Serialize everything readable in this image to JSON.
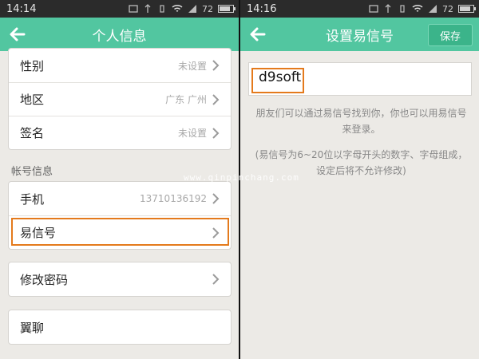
{
  "left": {
    "status": {
      "time": "14:14",
      "battery": "72",
      "battery_level": 0.72
    },
    "header": {
      "title": "个人信息"
    },
    "profile_rows": [
      {
        "label": "性别",
        "value": "未设置"
      },
      {
        "label": "地区",
        "value": "广东 广州"
      },
      {
        "label": "签名",
        "value": "未设置"
      }
    ],
    "account_section": {
      "title": "帐号信息",
      "rows": [
        {
          "label": "手机",
          "value": "13710136192"
        },
        {
          "label": "易信号",
          "value": ""
        }
      ]
    },
    "change_password": {
      "label": "修改密码"
    },
    "yiliao": {
      "label": "翼聊"
    }
  },
  "right": {
    "status": {
      "time": "14:16",
      "battery": "72",
      "battery_level": 0.72
    },
    "header": {
      "title": "设置易信号",
      "save_label": "保存"
    },
    "id_input": {
      "value": "d9soft"
    },
    "hint1": "朋友们可以通过易信号找到你，你也可以用易信号来登录。",
    "hint2": "(易信号为6~20位以字母开头的数字、字母组成，设定后将不允许修改)"
  },
  "watermark": "www.qinpinchang.com",
  "colors": {
    "accent": "#52c6a0",
    "highlight": "#e47a1c",
    "background": "#eceae6"
  },
  "icons": [
    "back-arrow-icon",
    "chevron-right-icon",
    "wifi-icon",
    "signal-icon",
    "battery-icon",
    "notification-icon",
    "usb-icon"
  ]
}
